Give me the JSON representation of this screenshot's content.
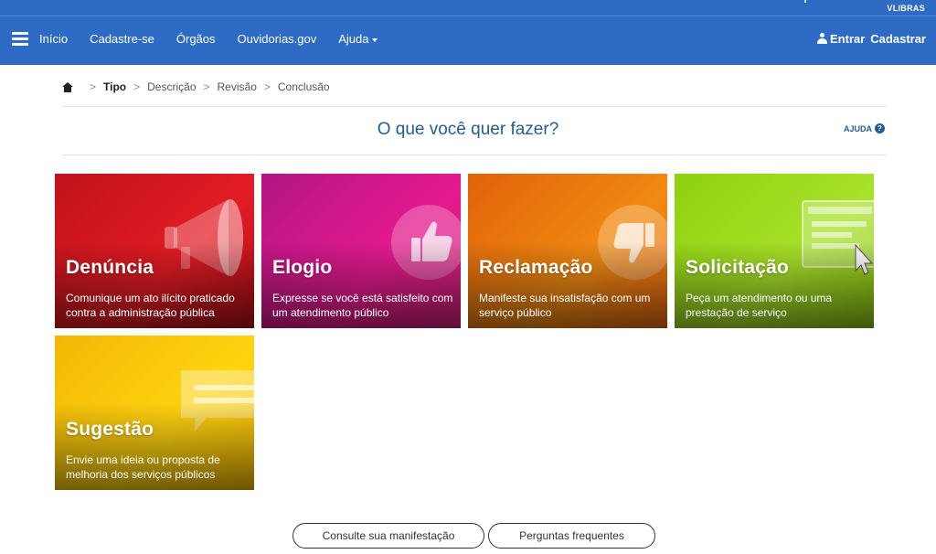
{
  "topbar": {
    "accessibility_label": "VLIBRAS",
    "nav_items": [
      "Início",
      "Cadastre-se",
      "Órgãos",
      "Ouvidorias.gov",
      "Ajuda"
    ],
    "login_label": "Entrar",
    "register_label": "Cadastrar"
  },
  "breadcrumb": {
    "steps": [
      "Tipo",
      "Descrição",
      "Revisão",
      "Conclusão"
    ],
    "current": "Tipo"
  },
  "page": {
    "heading": "O que você quer fazer?",
    "help_label": "AJUDA",
    "help_icon": "?"
  },
  "cards": [
    {
      "title": "Denúncia",
      "description": "Comunique um ato ilícito praticado contra a administração pública",
      "icon": "megaphone-icon",
      "color": "#e31c24"
    },
    {
      "title": "Elogio",
      "description": "Expresse se você está satisfeito com um atendimento público",
      "icon": "thumbs-up-icon",
      "color": "#e51a8f"
    },
    {
      "title": "Reclamação",
      "description": "Manifeste sua insatisfação com um serviço público",
      "icon": "thumbs-down-icon",
      "color": "#f08a12"
    },
    {
      "title": "Solicitação",
      "description": "Peça um atendimento ou uma prestação de serviço",
      "icon": "monitor-cursor-icon",
      "color": "#a8e22a"
    },
    {
      "title": "Sugestão",
      "description": "Envie uma ideia ou proposta de melhoria dos serviços públicos",
      "icon": "speech-bubble-icon",
      "color": "#ffd40f"
    }
  ],
  "footer_buttons": {
    "consult": "Consulte sua manifestação",
    "faq": "Perguntas frequentes"
  },
  "colors": {
    "header_bg": "#2d6bc4",
    "heading_text": "#1f5d92"
  }
}
